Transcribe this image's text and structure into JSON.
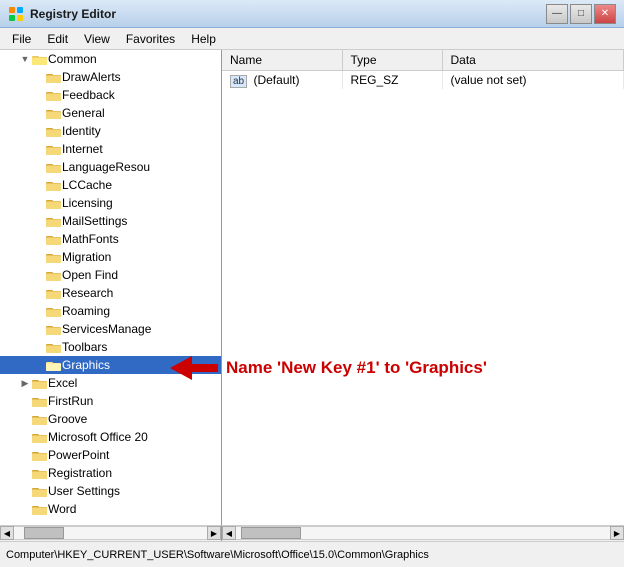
{
  "window": {
    "title": "Registry Editor",
    "title_icon": "registry",
    "buttons": {
      "minimize": "—",
      "maximize": "□",
      "close": "✕"
    }
  },
  "menu": {
    "items": [
      "File",
      "Edit",
      "View",
      "Favorites",
      "Help"
    ]
  },
  "tree": {
    "items": [
      {
        "label": "Common",
        "level": 1,
        "expanded": true,
        "selected": false
      },
      {
        "label": "DrawAlerts",
        "level": 2,
        "expanded": false,
        "selected": false
      },
      {
        "label": "Feedback",
        "level": 2,
        "expanded": false,
        "selected": false
      },
      {
        "label": "General",
        "level": 2,
        "expanded": false,
        "selected": false
      },
      {
        "label": "Identity",
        "level": 2,
        "expanded": false,
        "selected": false
      },
      {
        "label": "Internet",
        "level": 2,
        "expanded": false,
        "selected": false
      },
      {
        "label": "LanguageResou",
        "level": 2,
        "expanded": false,
        "selected": false
      },
      {
        "label": "LCCache",
        "level": 2,
        "expanded": false,
        "selected": false
      },
      {
        "label": "Licensing",
        "level": 2,
        "expanded": false,
        "selected": false
      },
      {
        "label": "MailSettings",
        "level": 2,
        "expanded": false,
        "selected": false
      },
      {
        "label": "MathFonts",
        "level": 2,
        "expanded": false,
        "selected": false
      },
      {
        "label": "Migration",
        "level": 2,
        "expanded": false,
        "selected": false
      },
      {
        "label": "Open Find",
        "level": 2,
        "expanded": false,
        "selected": false
      },
      {
        "label": "Research",
        "level": 2,
        "expanded": false,
        "selected": false
      },
      {
        "label": "Roaming",
        "level": 2,
        "expanded": false,
        "selected": false
      },
      {
        "label": "ServicesManage",
        "level": 2,
        "expanded": false,
        "selected": false
      },
      {
        "label": "Toolbars",
        "level": 2,
        "expanded": false,
        "selected": false
      },
      {
        "label": "Graphics",
        "level": 2,
        "expanded": false,
        "selected": true
      },
      {
        "label": "Excel",
        "level": 1,
        "expanded": false,
        "selected": false
      },
      {
        "label": "FirstRun",
        "level": 1,
        "expanded": false,
        "selected": false
      },
      {
        "label": "Groove",
        "level": 1,
        "expanded": false,
        "selected": false
      },
      {
        "label": "Microsoft Office 20",
        "level": 1,
        "expanded": false,
        "selected": false
      },
      {
        "label": "PowerPoint",
        "level": 1,
        "expanded": false,
        "selected": false
      },
      {
        "label": "Registration",
        "level": 1,
        "expanded": false,
        "selected": false
      },
      {
        "label": "User Settings",
        "level": 1,
        "expanded": false,
        "selected": false
      },
      {
        "label": "Word",
        "level": 1,
        "expanded": false,
        "selected": false
      }
    ]
  },
  "table": {
    "headers": [
      "Name",
      "Type",
      "Data"
    ],
    "rows": [
      {
        "icon": "ab",
        "name": "(Default)",
        "type": "REG_SZ",
        "data": "(value not set)"
      }
    ]
  },
  "annotation": {
    "text": "Name 'New Key #1' to 'Graphics'",
    "arrow": "←"
  },
  "status_bar": {
    "text": "Computer\\HKEY_CURRENT_USER\\Software\\Microsoft\\Office\\15.0\\Common\\Graphics"
  }
}
